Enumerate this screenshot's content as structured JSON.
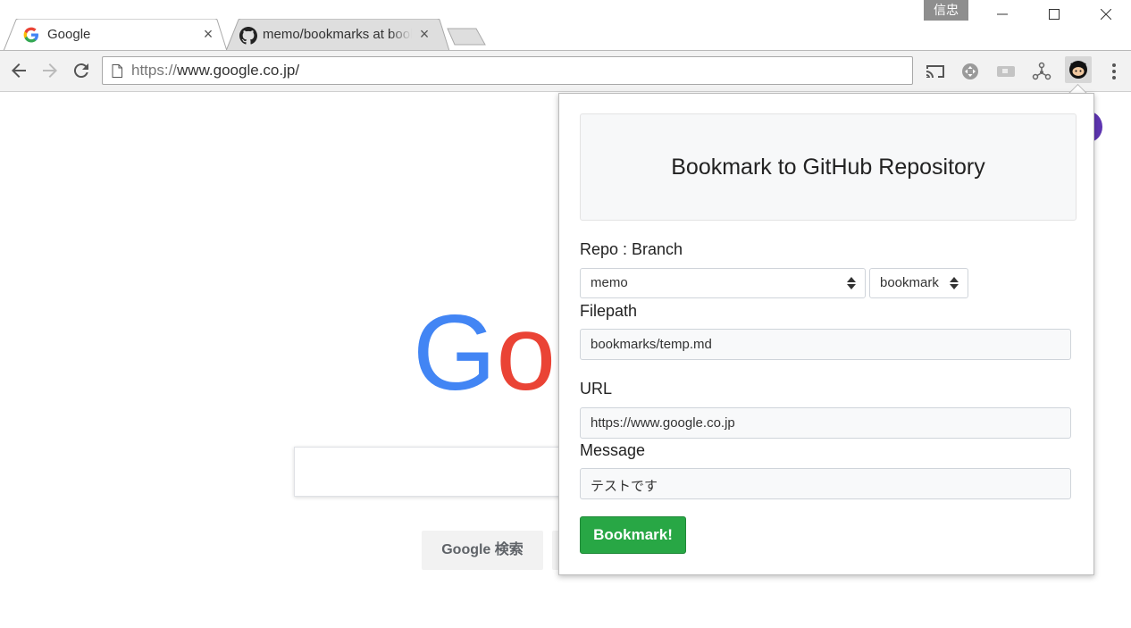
{
  "window": {
    "profile_name": "信忠"
  },
  "tabs": [
    {
      "title": "Google",
      "icon": "google-g-icon",
      "active": true
    },
    {
      "title": "memo/bookmarks at bookmark",
      "icon": "github-icon",
      "active": false
    }
  ],
  "toolbar": {
    "url_scheme": "https://",
    "url_rest": "www.google.co.jp/",
    "extensions": [
      "cast-icon",
      "extension-puzzle-icon",
      "screen-icon",
      "network-icon",
      "github-octocat-icon"
    ]
  },
  "google": {
    "logo_partial": "Goo",
    "search_button": "Google 検索"
  },
  "popup": {
    "title": "Bookmark to GitHub Repository",
    "repo_branch_label": "Repo : Branch",
    "repo_value": "memo",
    "branch_value": "bookmark",
    "filepath_label": "Filepath",
    "filepath_value": "bookmarks/temp.md",
    "url_label": "URL",
    "url_value": "https://www.google.co.jp",
    "message_label": "Message",
    "message_value": "テストです",
    "submit_label": "Bookmark!"
  },
  "colors": {
    "submit": "#28a745",
    "google_blue": "#4285f4",
    "google_red": "#ea4335",
    "google_yellow": "#fbbc05"
  }
}
